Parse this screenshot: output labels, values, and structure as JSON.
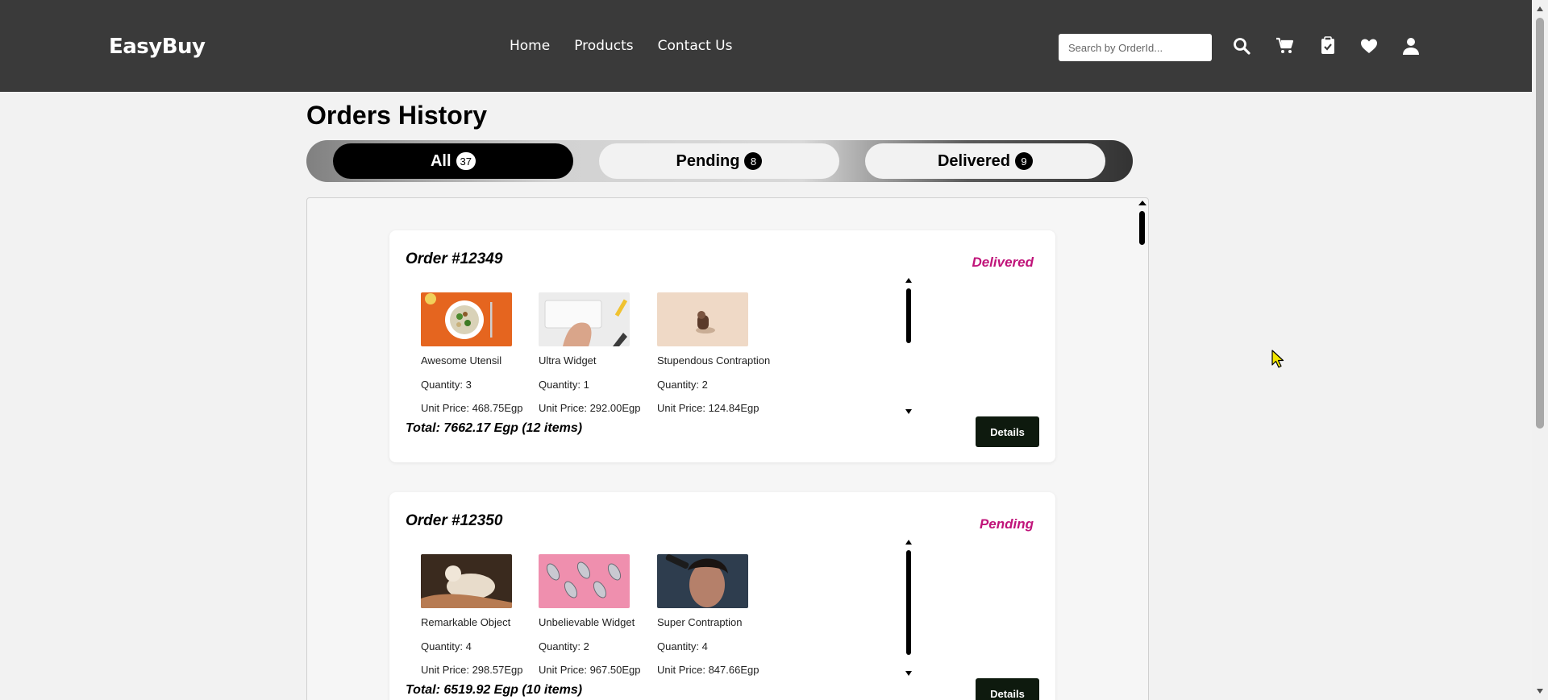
{
  "header": {
    "brand": "EasyBuy",
    "nav": [
      "Home",
      "Products",
      "Contact Us"
    ],
    "search_placeholder": "Search by OrderId...",
    "icons": [
      "search-icon",
      "cart-icon",
      "orders-clipboard-icon",
      "heart-icon",
      "user-icon"
    ]
  },
  "page": {
    "title": "Orders History"
  },
  "tabs": [
    {
      "label": "All",
      "count": "37"
    },
    {
      "label": "Pending",
      "count": "8"
    },
    {
      "label": "Delivered",
      "count": "9"
    }
  ],
  "orders": [
    {
      "order_no": "Order #12349",
      "status": "Delivered",
      "items": [
        {
          "name": "Awesome Utensil",
          "quantity": "Quantity: 3",
          "unit_price": "Unit Price: 468.75Egp"
        },
        {
          "name": "Ultra Widget",
          "quantity": "Quantity: 1",
          "unit_price": "Unit Price: 292.00Egp"
        },
        {
          "name": "Stupendous Contraption",
          "quantity": "Quantity: 2",
          "unit_price": "Unit Price: 124.84Egp"
        }
      ],
      "total": "Total: 7662.17 Egp (12 items)",
      "details_label": "Details"
    },
    {
      "order_no": "Order #12350",
      "status": "Pending",
      "items": [
        {
          "name": "Remarkable Object",
          "quantity": "Quantity: 4",
          "unit_price": "Unit Price: 298.57Egp"
        },
        {
          "name": "Unbelievable Widget",
          "quantity": "Quantity: 2",
          "unit_price": "Unit Price: 967.50Egp"
        },
        {
          "name": "Super Contraption",
          "quantity": "Quantity: 4",
          "unit_price": "Unit Price: 847.66Egp"
        }
      ],
      "total": "Total: 6519.92 Egp (10 items)",
      "details_label": "Details"
    }
  ],
  "colors": {
    "header_bg": "#3a3a3a",
    "status": "#c0147a",
    "details_button": "#0e1a0e"
  }
}
